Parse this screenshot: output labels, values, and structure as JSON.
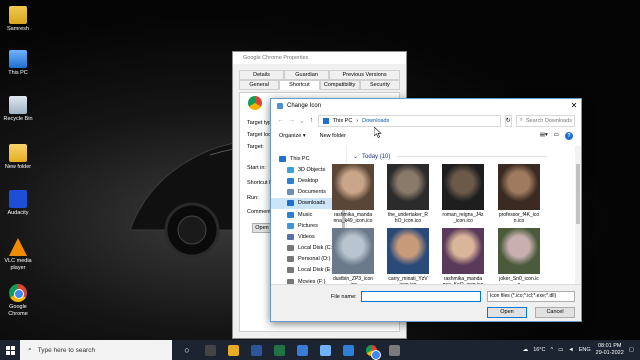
{
  "desktop": {
    "icons": [
      {
        "label": "Samresh",
        "icon": "user-folder-icon"
      },
      {
        "label": "This PC",
        "icon": "computer-icon"
      },
      {
        "label": "Recycle Bin",
        "icon": "recycle-bin-icon"
      },
      {
        "label": "New folder",
        "icon": "folder-icon"
      },
      {
        "label": "Audacity",
        "icon": "audacity-icon"
      },
      {
        "label": "VLC media player",
        "icon": "vlc-icon"
      },
      {
        "label": "Google Chrome",
        "icon": "chrome-icon"
      }
    ]
  },
  "props": {
    "title": "Google Chrome Properties",
    "tabs_row1": [
      "Details",
      "Guardian",
      "Previous Versions"
    ],
    "tabs_row2": [
      "General",
      "Shortcut",
      "Compatibility",
      "Security"
    ],
    "labels": [
      "Target typ",
      "Target loc",
      "Target:",
      "Start in:",
      "Shortcut k",
      "Run:",
      "Comment:"
    ],
    "open_btn": "Open"
  },
  "dialog": {
    "title": "Change Icon",
    "breadcrumb": [
      "This PC",
      "Downloads"
    ],
    "search_placeholder": "Search Downloads",
    "organize": "Organize ▾",
    "new_folder": "New folder",
    "nav": [
      {
        "label": "This PC",
        "color": "#1f6fd1"
      },
      {
        "label": "3D Objects",
        "color": "#3aa0e0"
      },
      {
        "label": "Desktop",
        "color": "#2d7fd8"
      },
      {
        "label": "Documents",
        "color": "#6a8fb8"
      },
      {
        "label": "Downloads",
        "color": "#1f6fd1",
        "selected": true
      },
      {
        "label": "Music",
        "color": "#2d7fd8"
      },
      {
        "label": "Pictures",
        "color": "#3a9ad9"
      },
      {
        "label": "Videos",
        "color": "#5a6fb0"
      },
      {
        "label": "Local Disk (C:)",
        "color": "#777"
      },
      {
        "label": "Personal (D:)",
        "color": "#777"
      },
      {
        "label": "Local Disk (E:)",
        "color": "#777"
      },
      {
        "label": "Movies (F:)",
        "color": "#777"
      }
    ],
    "group_label": "Today (10)",
    "files": [
      {
        "line1": "rashmika_manda",
        "line2": "nna_k49_icon.ico",
        "c1": "#5a4636",
        "c2": "#c9a58a"
      },
      {
        "line1": "the_undertaker_R",
        "line2": "hO_icon.ico",
        "c1": "#2b2b2b",
        "c2": "#8a7a6a"
      },
      {
        "line1": "roman_reigns_J4z",
        "line2": "_icon.ico",
        "c1": "#1e1e1e",
        "c2": "#6b5a4a"
      },
      {
        "line1": "professor_f4K_ico",
        "line2": "n.ico",
        "c1": "#3a2a22",
        "c2": "#a07a5e"
      },
      {
        "line1": "dustbin_ZP3_icon",
        "line2": ".ico",
        "c1": "#6a7a8a",
        "c2": "#b8c4cf"
      },
      {
        "line1": "carry_minati_YzV",
        "line2": "icon.ico",
        "c1": "#2a4a7a",
        "c2": "#c79a7a"
      },
      {
        "line1": "rashmika_manda",
        "line2": "nna_KeQ_icon.ico",
        "c1": "#5a3a5a",
        "c2": "#d9b59a"
      },
      {
        "line1": "joker_Sn0_icon.ic",
        "line2": "o",
        "c1": "#4a5a3a",
        "c2": "#c9b0b0"
      }
    ],
    "file_name_label": "File name:",
    "file_name_value": "",
    "filter": "Icon files (*.ico;*.icl;*.exe;*.dll)",
    "open": "Open",
    "cancel": "Cancel"
  },
  "taskbar": {
    "search_placeholder": "Type here to search",
    "weather": "16°C",
    "lang": "ENG",
    "time": "08:01 PM",
    "date": "29-01-2022"
  }
}
